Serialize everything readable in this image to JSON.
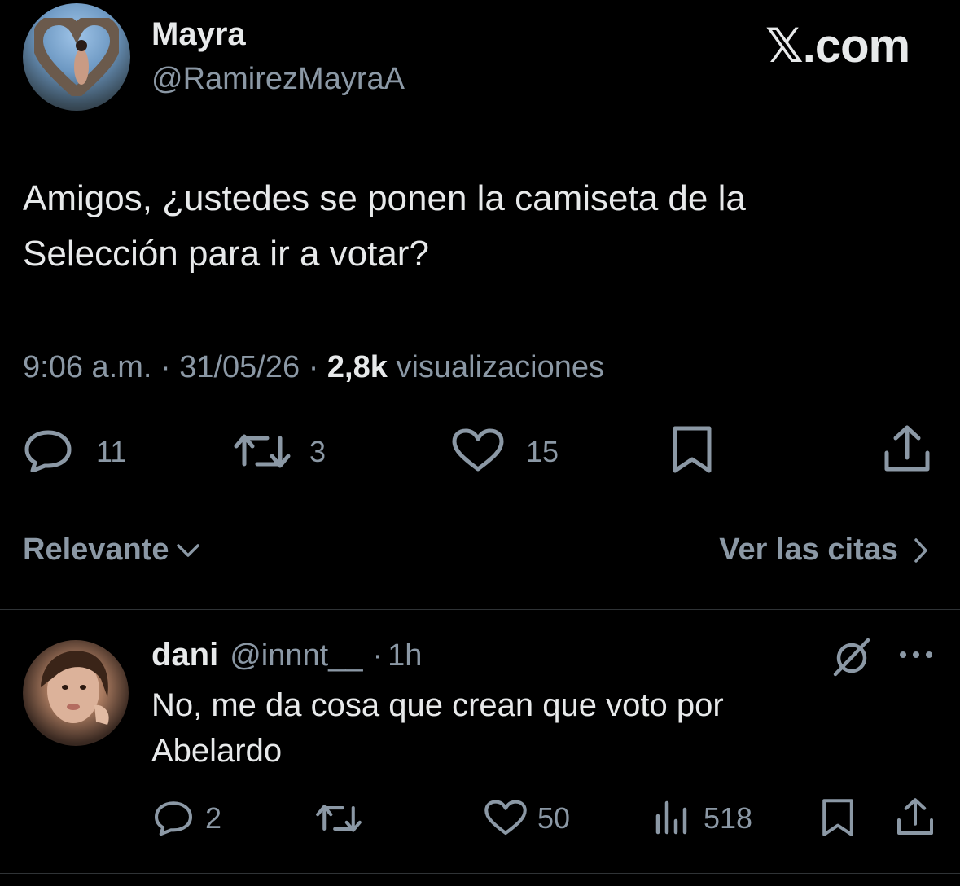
{
  "brand": {
    "logo_text": "𝕏.com"
  },
  "tweet": {
    "author_name": "Mayra",
    "author_handle": "@RamirezMayraA",
    "text_line1": "Amigos, ¿ustedes se ponen la camiseta de la",
    "text_line2": "Selección para ir a votar?",
    "time": "9:06 a.m.",
    "date": "31/05/26",
    "views_count": "2,8k",
    "views_label": "visualizaciones",
    "replies": "11",
    "retweets": "3",
    "likes": "15"
  },
  "filters": {
    "sort_label": "Relevante",
    "quotes_label": "Ver las citas"
  },
  "reply": {
    "author_name": "dani",
    "author_handle": "@innnt__",
    "time_ago": "1h",
    "text_line1": "No, me da cosa que crean que voto por",
    "text_line2": "Abelardo",
    "replies": "2",
    "retweets": "",
    "likes": "50",
    "views": "518"
  },
  "icons": {
    "reply": "reply-icon",
    "retweet": "retweet-icon",
    "like": "heart-icon",
    "bookmark": "bookmark-icon",
    "share": "share-icon",
    "views": "analytics-icon",
    "more": "more-icon",
    "grok": "grok-icon",
    "chevron_down": "chevron-down-icon",
    "chevron_right": "chevron-right-icon"
  }
}
